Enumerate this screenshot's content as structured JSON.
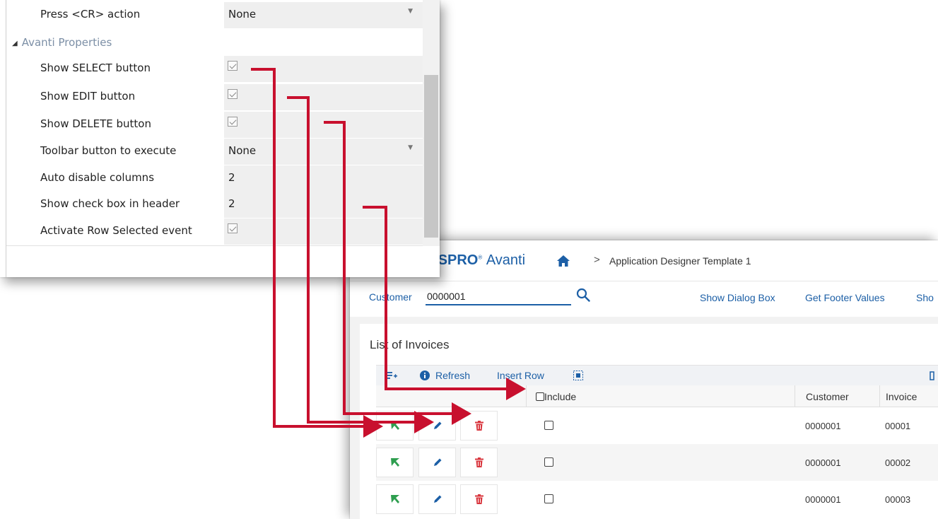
{
  "properties_panel": {
    "rows": [
      {
        "label": "Press <CR> action",
        "value": "None",
        "kind": "dropdown"
      },
      {
        "label": "Show SELECT button",
        "value": "",
        "kind": "checkbox",
        "checked": true
      },
      {
        "label": "Show EDIT button",
        "value": "",
        "kind": "checkbox",
        "checked": true
      },
      {
        "label": "Show DELETE button",
        "value": "",
        "kind": "checkbox",
        "checked": true
      },
      {
        "label": "Toolbar button to execute",
        "value": "None",
        "kind": "dropdown"
      },
      {
        "label": "Auto disable columns",
        "value": "2",
        "kind": "text"
      },
      {
        "label": "Show check box in header",
        "value": "2",
        "kind": "text"
      },
      {
        "label": "Activate Row Selected event",
        "value": "",
        "kind": "checkbox",
        "checked": true
      }
    ],
    "group_header": "Avanti Properties"
  },
  "avanti": {
    "brand": "SYSPRO",
    "brand_suffix": "Avanti",
    "breadcrumb_sep": ">",
    "breadcrumb": "Application Designer Template 1",
    "customer_label": "Customer",
    "customer_value": "0000001",
    "toolbar_links": [
      "Show Dialog Box",
      "Get Footer Values",
      "Sho"
    ],
    "list_title": "List of Invoices",
    "grid_toolbar": {
      "refresh": "Refresh",
      "insert_row": "Insert Row"
    },
    "columns": {
      "include": "Include",
      "customer": "Customer",
      "invoice": "Invoice"
    },
    "rows": [
      {
        "customer": "0000001",
        "invoice": "00001"
      },
      {
        "customer": "0000001",
        "invoice": "00002"
      },
      {
        "customer": "0000001",
        "invoice": "00003"
      }
    ]
  },
  "colors": {
    "accent_blue": "#1c5fa6",
    "arrow_red": "#c8102e",
    "select_green": "#2e9e4f",
    "delete_red": "#d9363e"
  }
}
